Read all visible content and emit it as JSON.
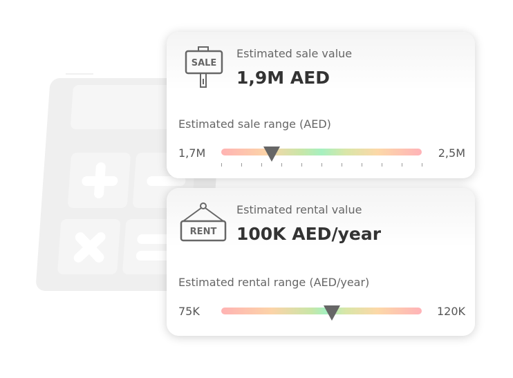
{
  "sale": {
    "icon": "sale-sign-icon",
    "icon_text": "SALE",
    "label": "Estimated sale value",
    "value": "1,9M AED",
    "range_label": "Estimated sale range (AED)",
    "min": "1,7M",
    "max": "2,5M",
    "position": 0.25
  },
  "rent": {
    "icon": "rent-sign-icon",
    "icon_text": "RENT",
    "label": "Estimated rental value",
    "value": "100K AED/year",
    "range_label": "Estimated rental range (AED/year)",
    "min": "75K",
    "max": "120K",
    "position": 0.55
  }
}
